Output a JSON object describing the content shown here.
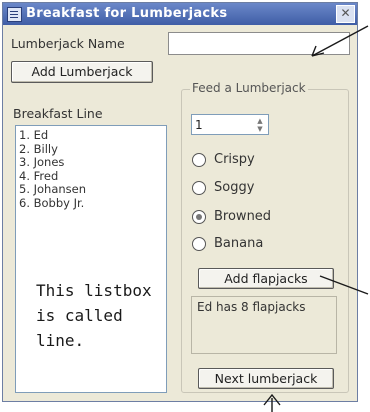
{
  "window": {
    "title": "Breakfast for Lumberjacks",
    "close_glyph": "✕"
  },
  "name_label": "Lumberjack Name",
  "name_input": {
    "value": ""
  },
  "add_lumberjack_label": "Add Lumberjack",
  "breakfast_line": {
    "label": "Breakfast Line",
    "items": [
      "1. Ed",
      "2. Billy",
      "3. Jones",
      "4. Fred",
      "5. Johansen",
      "6. Bobby Jr."
    ]
  },
  "feed_group": {
    "title": "Feed a Lumberjack",
    "quantity": "1",
    "options": [
      {
        "label": "Crispy",
        "checked": false
      },
      {
        "label": "Soggy",
        "checked": false
      },
      {
        "label": "Browned",
        "checked": true
      },
      {
        "label": "Banana",
        "checked": false
      }
    ],
    "add_flapjacks_label": "Add flapjacks",
    "status_text": "Ed has 8 flapjacks",
    "next_lumberjack_label": "Next lumberjack"
  },
  "annotation": {
    "lines": [
      "This listbox",
      "is called",
      "line."
    ]
  },
  "colors": {
    "title_bar": "#4a67b0",
    "window_bg": "#ece9d8",
    "annotation_ink": "#1a1a1a"
  }
}
